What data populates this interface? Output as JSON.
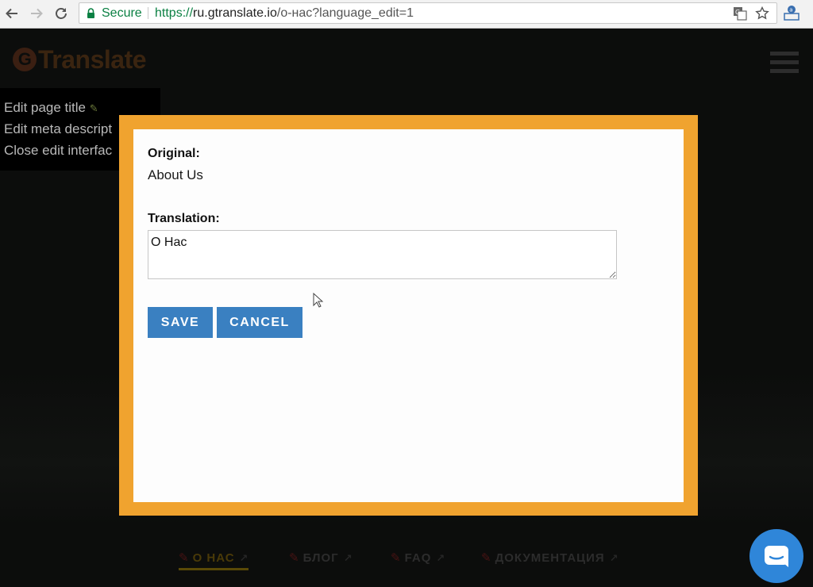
{
  "browser": {
    "secure_label": "Secure",
    "url_protocol": "https://",
    "url_host": "ru.gtranslate.io",
    "url_path": "/о-нас?language_edit=1"
  },
  "site": {
    "logo_text": "Translate",
    "edit_menu": [
      "Edit page title",
      "Edit meta descript",
      "Close edit interfac"
    ],
    "nav": [
      "О НАС",
      "БЛОГ",
      "FAQ",
      "ДОКУМЕНТАЦИЯ"
    ]
  },
  "modal": {
    "original_label": "Original:",
    "original_text": "About Us",
    "translation_label": "Translation:",
    "translation_value": "О Нас",
    "save_label": "SAVE",
    "cancel_label": "CANCEL",
    "border_color": "#f0a32f",
    "button_color": "#3a80c1"
  },
  "icons": [
    "back-arrow-icon",
    "forward-arrow-icon",
    "reload-icon",
    "lock-icon",
    "translate-icon",
    "star-icon",
    "extension-icon",
    "pencil-icon",
    "menu-icon",
    "chat-icon"
  ]
}
